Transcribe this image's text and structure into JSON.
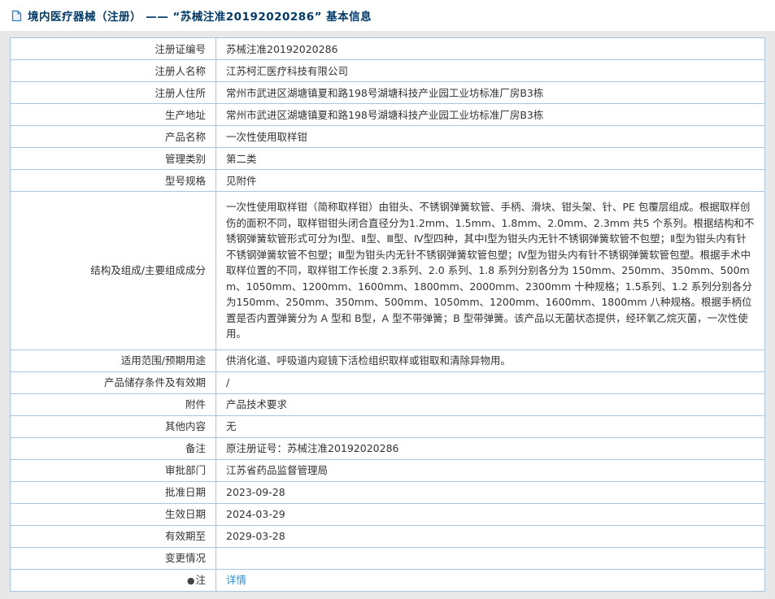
{
  "header": {
    "title": "境内医疗器械（注册） ——  “苏械注准20192020286” 基本信息"
  },
  "colors": {
    "accent_blue": "#2e7fc1",
    "title_blue": "#003a6b",
    "border_blue": "#a8c6e0",
    "link_blue": "#2b8fd0",
    "page_background": "#e8e8e8"
  },
  "icons": {
    "title_icon": "document-icon",
    "note_bullet": "●"
  },
  "table": {
    "rows": [
      {
        "label": "注册证编号",
        "value": "苏械注准20192020286"
      },
      {
        "label": "注册人名称",
        "value": "江苏柯汇医疗科技有限公司"
      },
      {
        "label": "注册人住所",
        "value": "常州市武进区湖塘镇夏和路198号湖塘科技产业园工业坊标准厂房B3栋"
      },
      {
        "label": "生产地址",
        "value": "常州市武进区湖塘镇夏和路198号湖塘科技产业园工业坊标准厂房B3栋"
      },
      {
        "label": "产品名称",
        "value": "一次性使用取样钳"
      },
      {
        "label": "管理类别",
        "value": "第二类"
      },
      {
        "label": "型号规格",
        "value": "见附件"
      },
      {
        "label": "结构及组成/主要组成成分",
        "value": "一次性使用取样钳（简称取样钳）由钳头、不锈钢弹簧软管、手柄、滑块、钳头架、针、PE 包覆层组成。根据取样创伤的面积不同，取样钳钳头闭合直径分为1.2mm、1.5mm、1.8mm、2.0mm、2.3mm 共5 个系列。根据结构和不锈钢弹簧软管形式可分为Ⅰ型、Ⅱ型、Ⅲ型、Ⅳ型四种，其中Ⅰ型为钳头内无针不锈钢弹簧软管不包塑；Ⅱ型为钳头内有针不锈钢弹簧软管不包塑；Ⅲ型为钳头内无针不锈钢弹簧软管包塑；Ⅳ型为钳头内有针不锈钢弹簧软管包塑。根据手术中取样位置的不同，取样钳工作长度 2.3系列、2.0 系列、1.8 系列分别各分为 150mm、250mm、350mm、500mm、1050mm、1200mm、1600mm、1800mm、2000mm、2300mm 十种规格；1.5系列、1.2 系列分别各分为150mm、250mm、350mm、500mm、1050mm、1200mm、1600mm、1800mm 八种规格。根据手柄位置是否内置弹簧分为 A 型和 B型，A 型不带弹簧；B 型带弹簧。该产品以无菌状态提供，经环氧乙烷灭菌，一次性使用。",
        "multiline": true
      },
      {
        "label": "适用范围/预期用途",
        "value": "供消化道、呼吸道内窥镜下活检组织取样或钳取和清除异物用。"
      },
      {
        "label": "产品储存条件及有效期",
        "value": "/"
      },
      {
        "label": "附件",
        "value": "产品技术要求"
      },
      {
        "label": "其他内容",
        "value": "无"
      },
      {
        "label": "备注",
        "value": "原注册证号：苏械注准20192020286"
      },
      {
        "label": "审批部门",
        "value": "江苏省药品监督管理局"
      },
      {
        "label": "批准日期",
        "value": "2023-09-28"
      },
      {
        "label": "生效日期",
        "value": "2024-03-29"
      },
      {
        "label": "有效期至",
        "value": "2029-03-28"
      },
      {
        "label": "变更情况",
        "value": ""
      },
      {
        "label": "注",
        "value": "详情",
        "bullet": true,
        "link": true
      }
    ]
  }
}
